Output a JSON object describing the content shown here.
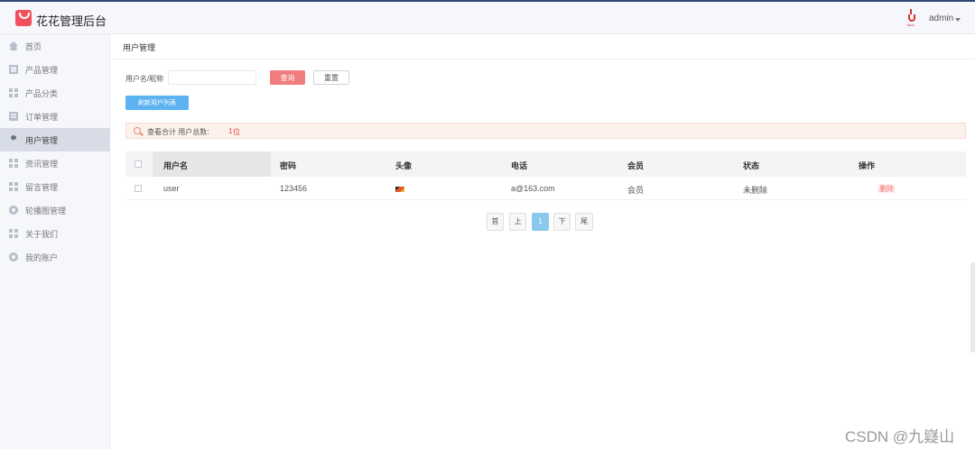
{
  "app": {
    "brand": "花花管理后台",
    "user": "admin"
  },
  "sidebar": {
    "items": [
      {
        "label": "首页",
        "icon": "home-icon"
      },
      {
        "label": "产品管理",
        "icon": "document-icon"
      },
      {
        "label": "产品分类",
        "icon": "grid-icon"
      },
      {
        "label": "订单管理",
        "icon": "list-icon"
      },
      {
        "label": "用户管理",
        "icon": "user-icon",
        "active": true
      },
      {
        "label": "资讯管理",
        "icon": "grid-icon"
      },
      {
        "label": "留言管理",
        "icon": "grid-icon"
      },
      {
        "label": "轮播图管理",
        "icon": "gear-icon"
      },
      {
        "label": "关于我们",
        "icon": "grid-icon"
      },
      {
        "label": "我的账户",
        "icon": "gear-icon"
      }
    ]
  },
  "page": {
    "title": "用户管理"
  },
  "filter": {
    "label": "用户名/昵称",
    "value": "",
    "query_label": "查询",
    "reset_label": "重置",
    "refresh_label": "刷新用户列表"
  },
  "summary": {
    "text": "查看合计  用户总数:",
    "count": "1",
    "unit": "位"
  },
  "table": {
    "headers": [
      "用户名",
      "密码",
      "头像",
      "电话",
      "会员",
      "状态",
      "操作"
    ],
    "rows": [
      {
        "username": "user",
        "password": "123456",
        "phone": "a@163.com",
        "member": "会员",
        "status": "未删除",
        "action": "删除"
      }
    ]
  },
  "pagination": {
    "first": "首",
    "prev": "上",
    "current": "1",
    "next": "下",
    "last": "尾"
  },
  "watermark": "CSDN @九嶷山",
  "colors": {
    "query_button": "#f07c7c",
    "refresh_button": "#5db2f2",
    "current_page": "#8bc9ec",
    "delete_link": "#ef6a6a"
  }
}
